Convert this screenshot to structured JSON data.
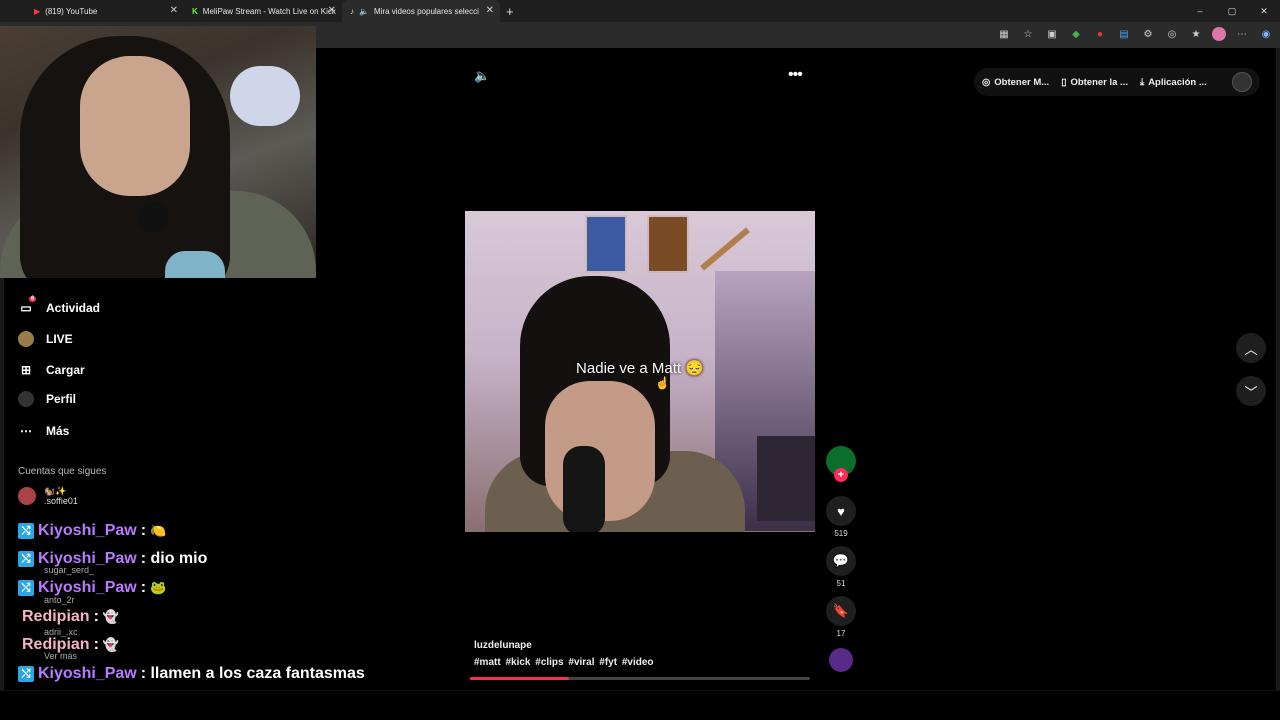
{
  "browser": {
    "tabs": [
      {
        "title": "(819) YouTube",
        "icon": "youtube-icon"
      },
      {
        "title": "MeliPaw Stream - Watch Live on Kick",
        "icon": "kick-icon"
      },
      {
        "title": "Mira videos populares selecci",
        "icon": "tiktok-icon"
      }
    ],
    "new_tab": "+",
    "window_controls": [
      "–",
      "▢",
      "✕"
    ]
  },
  "sidebar": {
    "items": [
      {
        "label": "Actividad",
        "icon": "activity-icon",
        "badge": "6"
      },
      {
        "label": "LIVE",
        "icon": "live-icon"
      },
      {
        "label": "Cargar",
        "icon": "upload-icon"
      },
      {
        "label": "Perfil",
        "icon": "profile-icon"
      },
      {
        "label": "Más",
        "icon": "more-icon"
      }
    ],
    "following_title": "Cuentas que sigues",
    "following": [
      {
        "name": ".soffie01",
        "emoji": "🐿️✨"
      }
    ]
  },
  "chat": {
    "messages": [
      {
        "user": "Kiyoshi_Paw",
        "text": ":",
        "emoji": "🍋",
        "color": "#b77cff"
      },
      {
        "user": "Kiyoshi_Paw",
        "text": ": dio mio",
        "emoji": "",
        "color": "#b77cff"
      },
      {
        "user": "Kiyoshi_Paw",
        "text": ":",
        "emoji": "🐸",
        "color": "#b77cff"
      },
      {
        "user": "Redipian",
        "text": ":",
        "emoji": "👻",
        "color": "#f5b3c4"
      },
      {
        "user": "Redipian",
        "text": ":",
        "emoji": "👻",
        "color": "#f5b3c4"
      },
      {
        "user": "Kiyoshi_Paw",
        "text": ": llamen a los caza fantasmas",
        "emoji": "",
        "color": "#b77cff"
      }
    ],
    "ghost_names": [
      "sugar_serd_",
      "anto_2r",
      "adrii_.xc",
      "Ver más"
    ]
  },
  "top_bar": {
    "items": [
      {
        "label": "Obtener M...",
        "icon": "coin-icon"
      },
      {
        "label": "Obtener la ...",
        "icon": "phone-icon"
      },
      {
        "label": "Aplicación ...",
        "icon": "download-icon"
      }
    ]
  },
  "video": {
    "caption": "Nadie ve a Matt 😔",
    "author": "luzdelunape",
    "tags": "#matt #kick #clips #viral #fyt #video",
    "likes": "519",
    "comments": "51",
    "saves": "17",
    "progress_percent": 29
  }
}
